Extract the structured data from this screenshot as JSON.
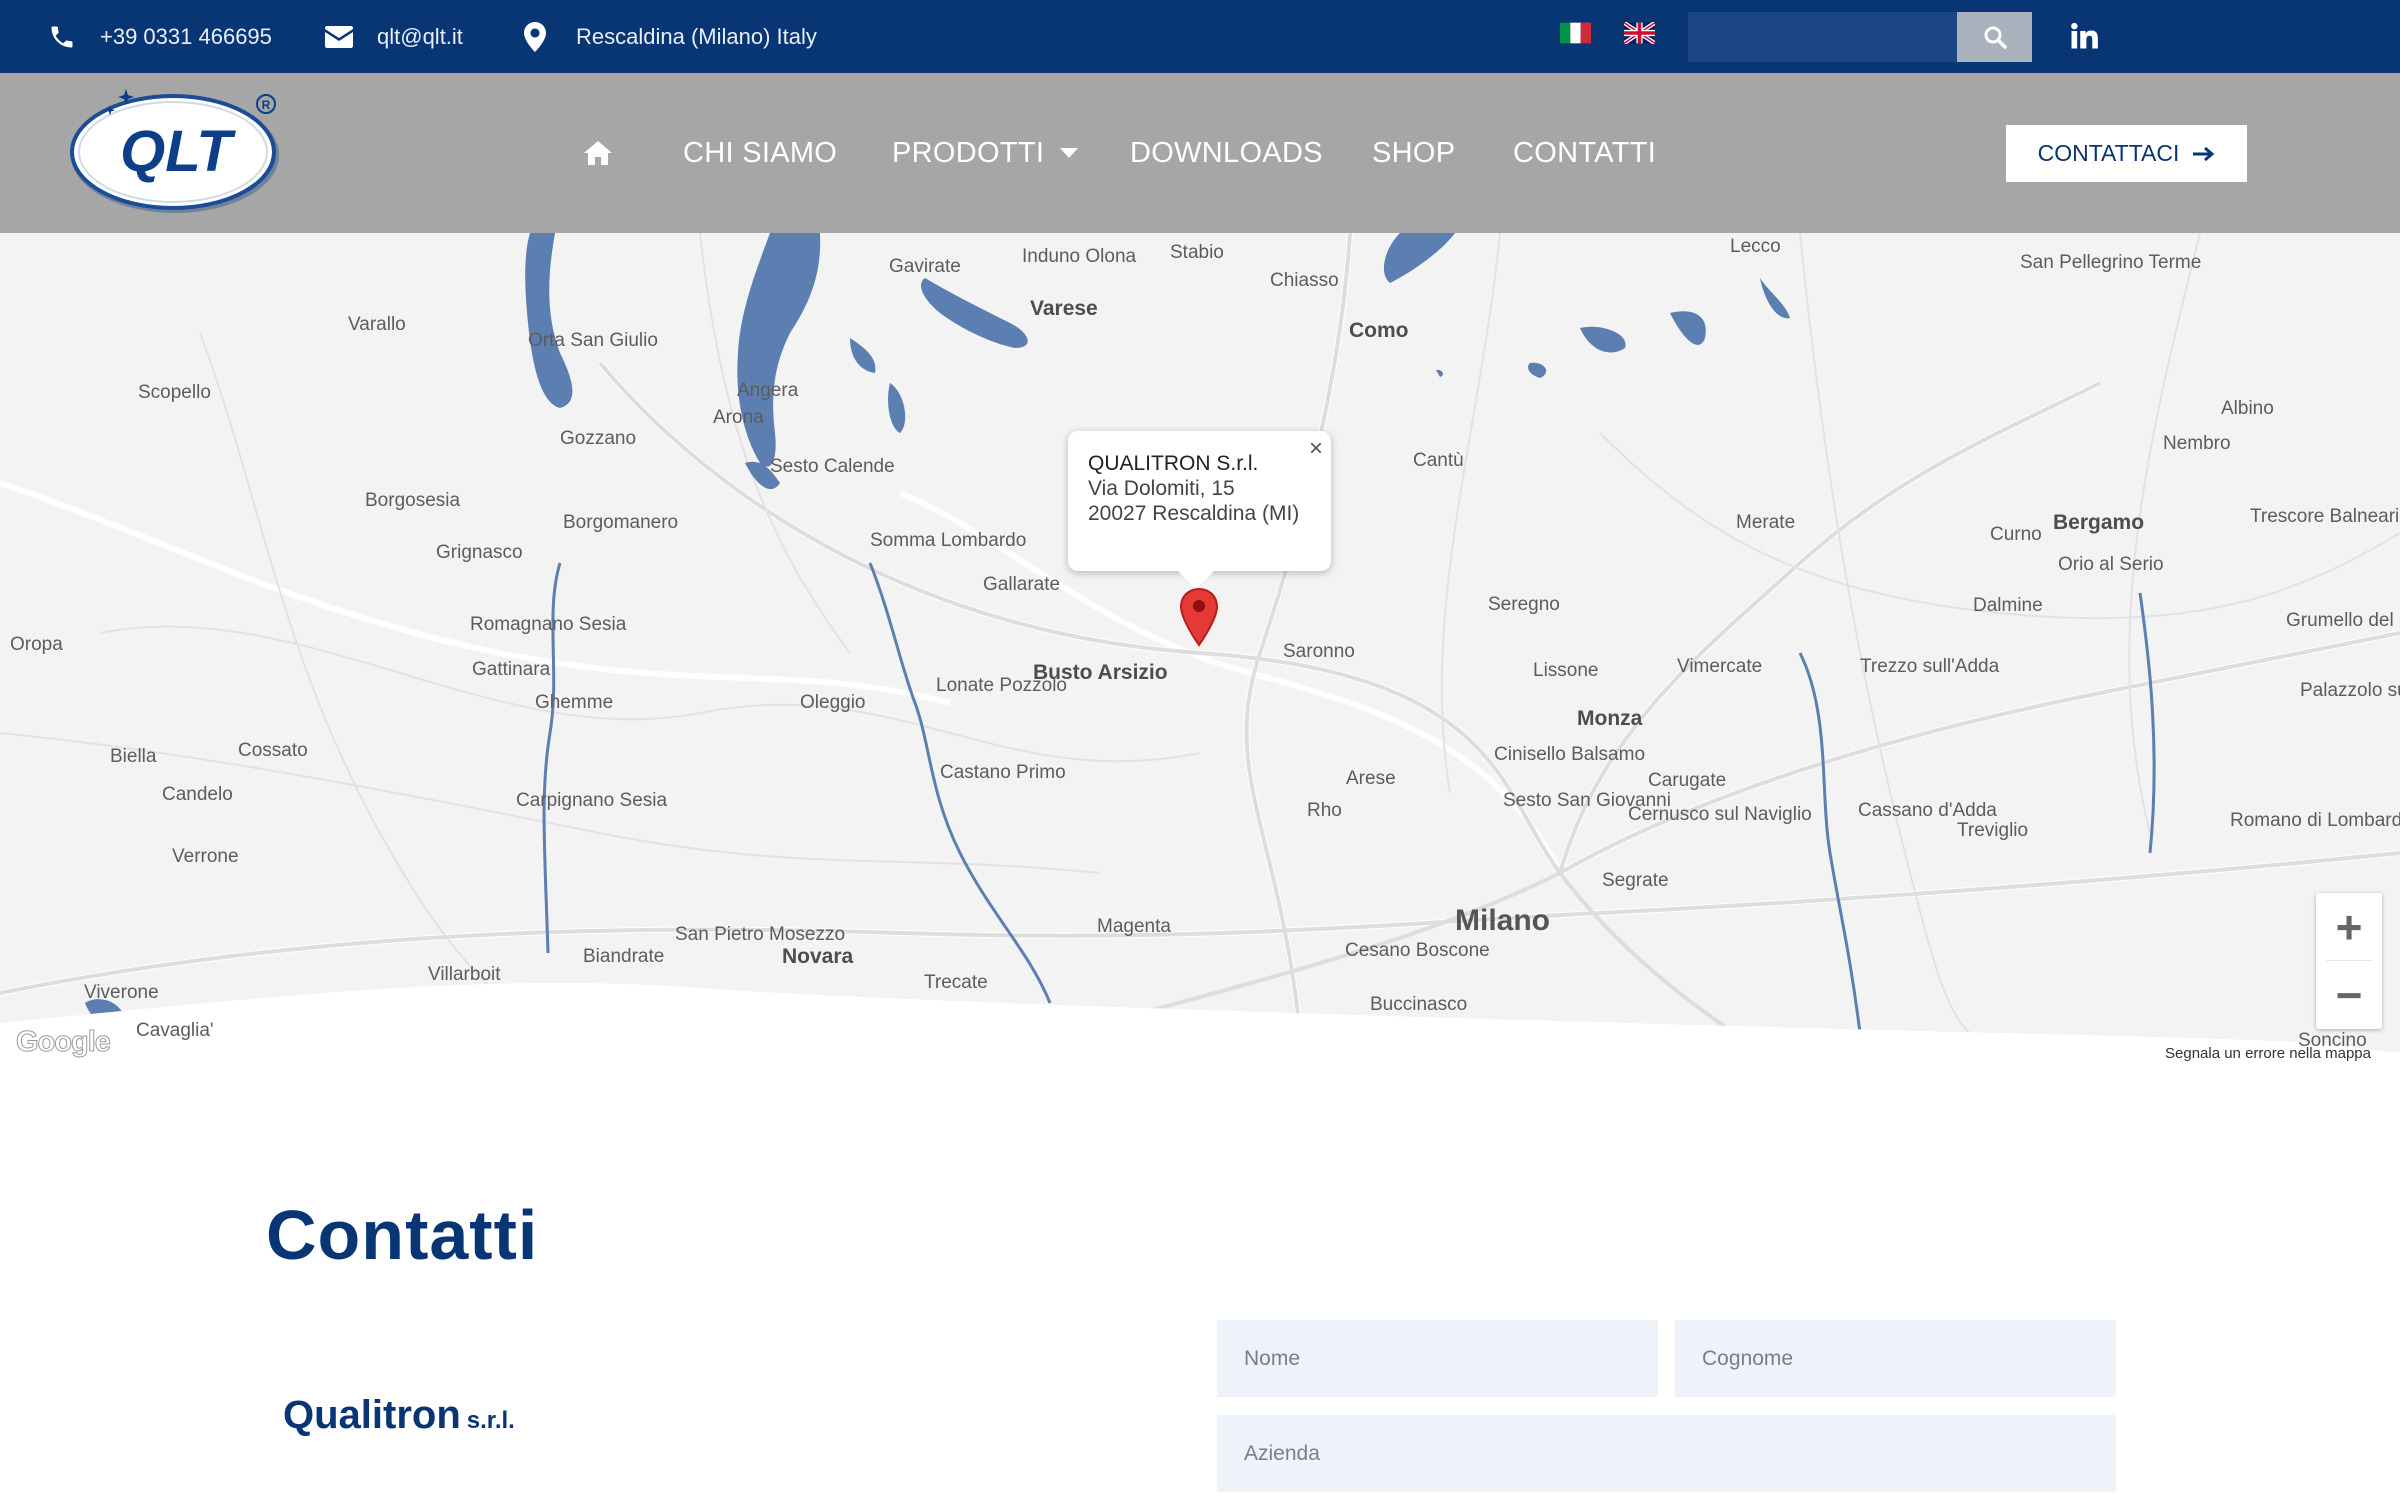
{
  "topbar": {
    "phone": "+39 0331 466695",
    "email": "qlt@qlt.it",
    "location": "Rescaldina (Milano) Italy",
    "search_placeholder": "",
    "icons": [
      "phone-icon",
      "envelope-icon",
      "map-marker-icon",
      "flag-italy-icon",
      "flag-uk-icon",
      "search-icon",
      "linkedin-icon"
    ]
  },
  "logo": {
    "text": "QLT",
    "registered": "®"
  },
  "nav": {
    "items": [
      "CHI SIAMO",
      "PRODOTTI",
      "DOWNLOADS",
      "SHOP",
      "CONTATTI"
    ],
    "cta": "CONTATTACI"
  },
  "map": {
    "popup": {
      "title": "QUALITRON S.r.l.",
      "line1": "Via Dolomiti, 15",
      "line2": "20027 Rescaldina (MI)"
    },
    "labels": {
      "gavirate": "Gavirate",
      "induno": "Induno Olona",
      "stabio": "Stabio",
      "lecco": "Lecco",
      "chiasso": "Chiasso",
      "sanpellegrino": "San Pellegrino Terme",
      "varallo": "Varallo",
      "varese": "Varese",
      "como": "Como",
      "orta": "Orta San Giulio",
      "scopello": "Scopello",
      "angera": "Angera",
      "arona": "Arona",
      "albino": "Albino",
      "gozzano": "Gozzano",
      "sesto": "Sesto Calende",
      "cantu": "Cantù",
      "nembro": "Nembro",
      "borgosesia": "Borgosesia",
      "borgomanero": "Borgomanero",
      "merate": "Merate",
      "trescore": "Trescore Balneario",
      "curno": "Curno",
      "bergamo": "Bergamo",
      "grignasco": "Grignasco",
      "somma": "Somma Lombardo",
      "gallarate": "Gallarate",
      "orio": "Orio al Serio",
      "seregno": "Seregno",
      "dalmine": "Dalmine",
      "oropa": "Oropa",
      "romagnano": "Romagnano Sesia",
      "grumello": "Grumello del Monte",
      "saronno": "Saronno",
      "gattinara": "Gattinara",
      "busto": "Busto Arsizio",
      "lonate": "Lonate Pozzolo",
      "lissone": "Lissone",
      "vimercate": "Vimercate",
      "trezzo": "Trezzo sull'Adda",
      "palazzolo": "Palazzolo sull'Oglio",
      "ghemme": "Ghemme",
      "oleggio": "Oleggio",
      "monza": "Monza",
      "biella": "Biella",
      "cossato": "Cossato",
      "cinisello": "Cinisello Balsamo",
      "castano": "Castano Primo",
      "arese": "Arese",
      "carugate": "Carugate",
      "candelo": "Candelo",
      "sesto_sg": "Sesto San Giovanni",
      "carpignano": "Carpignano Sesia",
      "rho": "Rho",
      "cernusco": "Cernusco sul Naviglio",
      "cassano": "Cassano d'Adda",
      "treviglio": "Treviglio",
      "romano": "Romano di Lombardia",
      "verrone": "Verrone",
      "segrate": "Segrate",
      "magenta": "Magenta",
      "milano": "Milano",
      "sanpietro": "San Pietro Mosezzo",
      "biandrate": "Biandrate",
      "novara": "Novara",
      "villarboit": "Villarboit",
      "cesano": "Cesano Boscone",
      "trecate": "Trecate",
      "viverone": "Viverone",
      "buccinasco": "Buccinasco",
      "cavaglia": "Cavaglia'",
      "soncino": "Soncino"
    },
    "zoom_in": "+",
    "zoom_out": "−",
    "google": "Google",
    "error_link": "Segnala un errore nella mappa"
  },
  "content": {
    "title": "Contatti",
    "company_name": "Qualitron",
    "company_suffix": "s.r.l."
  },
  "form": {
    "nome_placeholder": "Nome",
    "cognome_placeholder": "Cognome",
    "azienda_placeholder": "Azienda"
  },
  "colors": {
    "brand_blue": "#083574",
    "nav_gray": "#a6a6a6",
    "field_bg": "#eef3fa",
    "water": "#5b7fb0"
  }
}
